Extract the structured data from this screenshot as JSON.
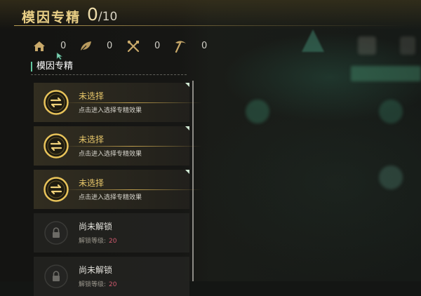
{
  "header": {
    "title": "模因专精",
    "count_current": "0",
    "count_max": "/10"
  },
  "stats": [
    {
      "icon": "house-icon",
      "value": "0"
    },
    {
      "icon": "leaf-icon",
      "value": "0"
    },
    {
      "icon": "tools-icon",
      "value": "0"
    },
    {
      "icon": "pickaxe-icon",
      "value": "0"
    }
  ],
  "section": {
    "title": "模因专精"
  },
  "slots": [
    {
      "state": "unselected",
      "label": "未选择",
      "sub": "点击进入选择专精效果"
    },
    {
      "state": "unselected",
      "label": "未选择",
      "sub": "点击进入选择专精效果"
    },
    {
      "state": "unselected",
      "label": "未选择",
      "sub": "点击进入选择专精效果"
    },
    {
      "state": "locked",
      "label": "尚未解锁",
      "sub": "解锁等级:",
      "level": "20"
    },
    {
      "state": "locked",
      "label": "尚未解锁",
      "sub": "解锁等级:",
      "level": "20"
    }
  ],
  "colors": {
    "accent_gold": "#e8c76a",
    "section_marker": "#63c7a0",
    "lock_level": "#d05a6e"
  }
}
